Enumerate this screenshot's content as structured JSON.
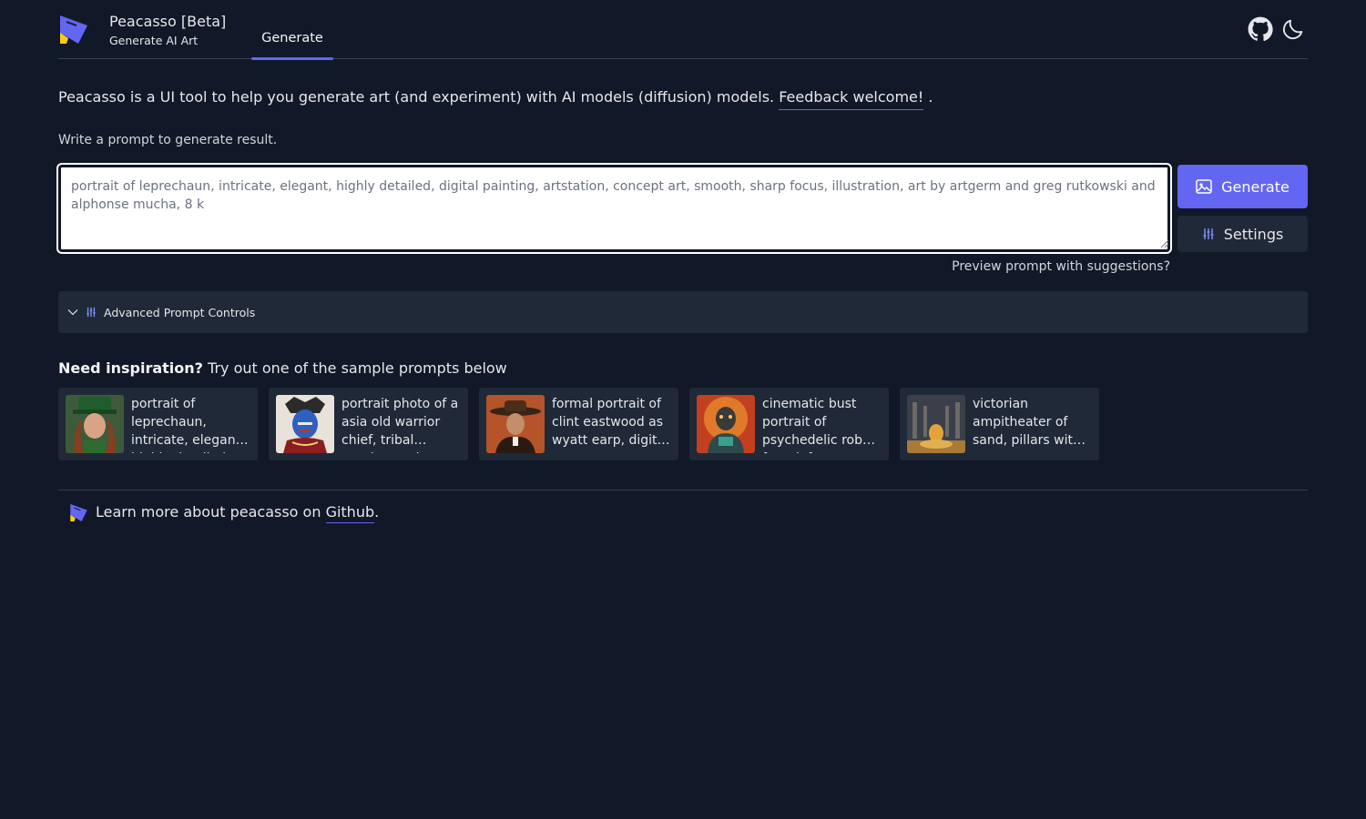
{
  "brand": {
    "title": "Peacasso [Beta]",
    "subtitle": "Generate AI Art",
    "logo": "peacasso-logo",
    "accent": "#6366f1"
  },
  "nav": {
    "tabs": [
      {
        "label": "Generate",
        "active": true
      }
    ]
  },
  "header_icons": [
    "github-icon",
    "moon-icon"
  ],
  "intro": {
    "text": "Peacasso is a UI tool to help you generate art (and experiment) with AI models (diffusion) models. ",
    "link": "Feedback welcome!",
    "suffix": " ."
  },
  "prompt": {
    "label": "Write a prompt to generate result.",
    "placeholder": "portrait of leprechaun, intricate, elegant, highly detailed, digital painting, artstation, concept art, smooth, sharp focus, illustration, art by artgerm and greg rutkowski and alphonse mucha, 8 k",
    "value": ""
  },
  "buttons": {
    "generate": "Generate",
    "settings": "Settings"
  },
  "preview_link": "Preview prompt with suggestions?",
  "advanced": {
    "label": "Advanced Prompt Controls",
    "expanded": false
  },
  "inspiration": {
    "bold": "Need inspiration?",
    "rest": " Try out one of the sample prompts below",
    "samples": [
      {
        "text": "portrait of leprechaun, intricate, elegant, highly detailed"
      },
      {
        "text": "portrait photo of a asia old warrior chief, tribal panther make up"
      },
      {
        "text": "formal portrait of clint eastwood as wyatt earp, digital art"
      },
      {
        "text": "cinematic bust portrait of psychedelic robot from left"
      },
      {
        "text": "victorian ampitheater of sand, pillars with statues on top"
      }
    ]
  },
  "footer": {
    "text": "Learn more about peacasso on ",
    "link": "Github",
    "suffix": "."
  }
}
